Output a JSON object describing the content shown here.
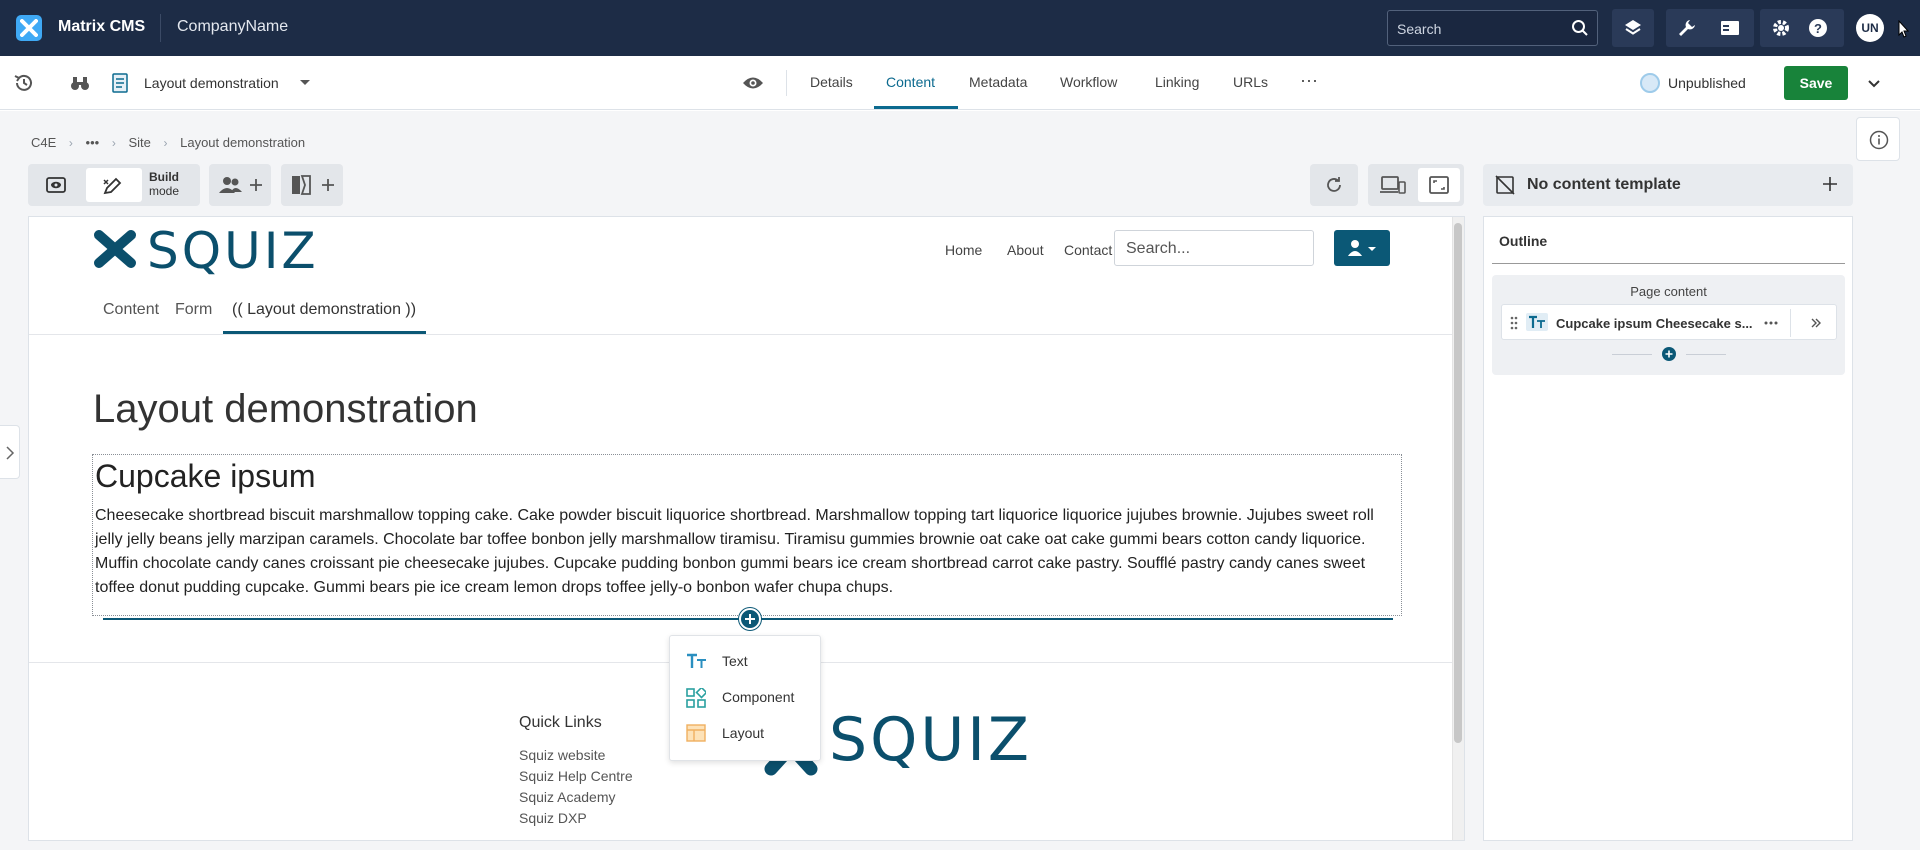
{
  "app": {
    "name": "Matrix CMS",
    "company": "CompanyName",
    "search_placeholder": "Search",
    "user_initials": "UN"
  },
  "toolbar": {
    "asset_name": "Layout demonstration",
    "tabs": [
      "Details",
      "Content",
      "Metadata",
      "Workflow",
      "Linking",
      "URLs"
    ],
    "active_tab": "Content",
    "more": "···",
    "status": "Unpublished",
    "save_label": "Save"
  },
  "breadcrumb": [
    "C4E",
    "•••",
    "Site",
    "Layout demonstration"
  ],
  "modes": {
    "build_label_line1": "Build",
    "build_label_line2": "mode"
  },
  "template": {
    "label": "No content template"
  },
  "outline": {
    "title": "Outline",
    "group_label": "Page content",
    "item_label": "Cupcake ipsum Cheesecake s..."
  },
  "site": {
    "nav": [
      "Home",
      "About",
      "Contact"
    ],
    "search_placeholder": "Search...",
    "tabs": [
      "Content",
      "Form",
      "(( Layout demonstration ))"
    ],
    "active_tab": "(( Layout demonstration ))",
    "page_title": "Layout demonstration",
    "block_heading": "Cupcake ipsum",
    "block_text": "Cheesecake shortbread biscuit marshmallow topping cake. Cake powder biscuit liquorice shortbread. Marshmallow topping tart liquorice liquorice jujubes brownie. Jujubes sweet roll jelly jelly beans jelly marzipan caramels. Chocolate bar toffee bonbon jelly marshmallow tiramisu. Tiramisu gummies brownie oat cake oat cake gummi bears cotton candy liquorice. Muffin chocolate candy canes croissant pie cheesecake jujubes. Cupcake pudding bonbon gummi bears ice cream shortbread carrot cake pastry. Soufflé pastry candy canes sweet toffee donut pudding cupcake. Gummi bears pie ice cream lemon drops toffee jelly-o bonbon wafer chupa chups.",
    "logo_text": "SQUIZ",
    "footer_title": "Quick Links",
    "footer_links": [
      "Squiz website",
      "Squiz Help Centre",
      "Squiz Academy",
      "Squiz DXP"
    ]
  },
  "insert_menu": {
    "items": [
      {
        "label": "Text",
        "icon": "text-type-icon"
      },
      {
        "label": "Component",
        "icon": "component-grid-icon"
      },
      {
        "label": "Layout",
        "icon": "layout-icon"
      }
    ]
  },
  "colors": {
    "topbar": "#1d2c46",
    "accent": "#0c6a8f",
    "brand": "#0b4f6c",
    "save": "#18833a"
  }
}
